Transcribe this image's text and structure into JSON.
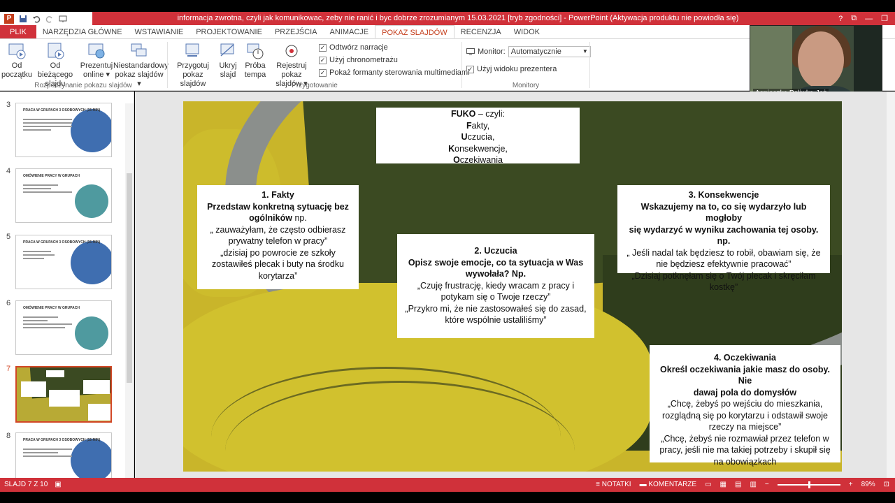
{
  "titlebar": {
    "title": "informacja zwrotna, czyli jak komunikowac, zeby nie ranić i byc dobrze zrozumianym 15.03.2021 [tryb zgodności] - PowerPoint (Aktywacja produktu nie powiodła się)",
    "app_icon": "P",
    "help": "?",
    "restore_ribbon": "⧉",
    "minimize": "—",
    "maximize": "❐",
    "close": "✕"
  },
  "tabs": [
    "PLIK",
    "NARZĘDZIA GŁÓWNE",
    "WSTAWIANIE",
    "PROJEKTOWANIE",
    "PRZEJŚCIA",
    "ANIMACJE",
    "POKAZ SLAJDÓW",
    "RECENZJA",
    "WIDOK"
  ],
  "active_tab_index": 6,
  "ribbon": {
    "start_group": {
      "label": "Rozpoczynanie pokazu slajdów",
      "from_start_1": "Od",
      "from_start_2": "początku",
      "from_current_1": "Od bieżącego",
      "from_current_2": "slajdu",
      "present_online_1": "Prezentuj",
      "present_online_2": "online ▾",
      "custom_show_1": "Niestandardowy",
      "custom_show_2": "pokaz slajdów ▾"
    },
    "setup_group": {
      "label": "Przygotowanie",
      "setup_1": "Przygotuj",
      "setup_2": "pokaz slajdów",
      "hide_1": "Ukryj",
      "hide_2": "slajd",
      "rehearse_1": "Próba",
      "rehearse_2": "tempa",
      "record_1": "Rejestruj pokaz",
      "record_2": "slajdów ▾",
      "chk_narration": "Odtwórz narracje",
      "chk_timings": "Użyj chronometrażu",
      "chk_controls": "Pokaż formanty sterowania multimediami"
    },
    "monitors_group": {
      "label": "Monitory",
      "monitor_label": "Monitor:",
      "monitor_value": "Automatycznie",
      "chk_presenter": "Użyj widoku prezentera"
    },
    "check_mark": "✓"
  },
  "webcam": {
    "name": "Agnieszka Poliwka-Jeż"
  },
  "thumbnails": [
    {
      "num": "3",
      "title": "PRACA W GRUPACH 3 OSOBOWYCH (15 MIN)",
      "style": "circle"
    },
    {
      "num": "4",
      "title": "OMÓWIENIE PRACY W GRUPACH",
      "style": "half"
    },
    {
      "num": "5",
      "title": "PRACA W GRUPACH 3 OSOBOWYCH (15 MIN)",
      "style": "circle"
    },
    {
      "num": "6",
      "title": "OMÓWIENIE PRACY W GRUPACH",
      "style": "half"
    },
    {
      "num": "7",
      "title": "",
      "style": "field"
    },
    {
      "num": "8",
      "title": "PRACA W GRUPACH 3 OSOBOWYCH (15 MIN)",
      "style": "circle"
    }
  ],
  "slide": {
    "fuko": {
      "line1_bold": "FUKO",
      "line1_rest": " – czyli:",
      "f_bold": "F",
      "f_rest": "akty,",
      "u_bold": "U",
      "u_rest": "czucia,",
      "k_bold": "K",
      "k_rest": "onsekwencje,",
      "o_bold": "O",
      "o_rest": "czekiwania"
    },
    "facts": {
      "heading": "1. Fakty",
      "bold1": "Przedstaw konkretną sytuację bez",
      "bold2": "ogólników",
      "rest2": " np.",
      "line3": "„ zauważyłam, że często odbierasz",
      "line4": "prywatny telefon w pracy”",
      "line5": "„dzisiaj po powrocie ze szkoły",
      "line6": "zostawiłeś plecak i buty na środku",
      "line7": "korytarza”"
    },
    "feelings": {
      "heading": "2. Uczucia",
      "bold1": "Opisz swoje emocje, co ta sytuacja w Was",
      "bold2": "wywołała? Np.",
      "line3": "„Czuję frustrację, kiedy wracam z pracy i",
      "line4": "potykam się o Twoje rzeczy”",
      "line5": "„Przykro mi, że nie zastosowałeś się do zasad,",
      "line6": "które wspólnie ustaliliśmy”"
    },
    "consequences": {
      "heading": "3. Konsekwencje",
      "bold1": "Wskazujemy na to, co się wydarzyło lub mogłoby",
      "bold2": "się wydarzyć w wyniku zachowania tej osoby. np.",
      "line3": "„ Jeśli nadal tak będziesz to robił, obawiam się, że",
      "line4": "nie będziesz efektywnie pracować”",
      "line5": "„Dzisiaj potknęłam się o Twój plecak i skręciłam",
      "line6": "kostkę”"
    },
    "expectations": {
      "heading": "4. Oczekiwania",
      "bold1": "Określ oczekiwania jakie masz do osoby. Nie",
      "bold2": "dawaj pola do domysłów",
      "line3": "„Chcę, żebyś po wejściu do mieszkania,",
      "line4": "rozglądną się po korytarzu i odstawił swoje",
      "line5": "rzeczy na miejsce”",
      "line6": "„Chcę, żebyś nie rozmawiał przez telefon w",
      "line7": "pracy, jeśli nie ma takiej potrzeby i skupił się",
      "line8": "na obowiązkach"
    }
  },
  "statusbar": {
    "slide_info": "SLAJD 7 Z 10",
    "notes": "NOTATKI",
    "comments": "KOMENTARZE",
    "zoom_out": "−",
    "zoom_in": "+",
    "zoom": "89%"
  },
  "colors": {
    "accent": "#d0313a",
    "active_tab": "#c43e1c"
  }
}
